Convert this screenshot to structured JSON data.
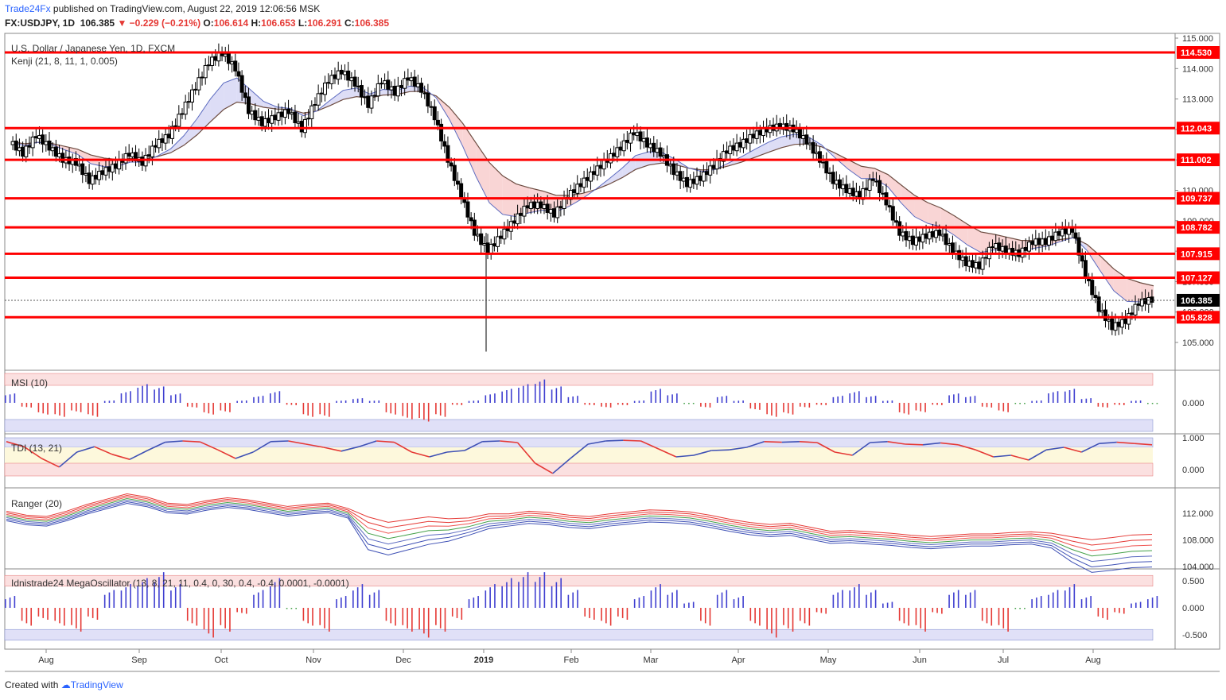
{
  "header": {
    "brand": "Trade24Fx",
    "published": " published on TradingView.com, August 22, 2019 12:06:56 MSK",
    "symbol": "FX:USDJPY, 1D",
    "last": "106.385",
    "arrow": "▼",
    "change": "−0.229 (−0.21%)",
    "o_label": "O:",
    "o": "106.614",
    "h_label": "H:",
    "h": "106.653",
    "l_label": "L:",
    "l": "106.291",
    "c_label": "C:",
    "c": "106.385"
  },
  "footer": {
    "created": "Created with",
    "tradingview": "TradingView"
  },
  "colors": {
    "red_line": "#ff0000",
    "buy": "#3f3fd0",
    "sell": "#e53935",
    "pink_zone": "#fbd8d8",
    "blue_zone": "#dcdcf5"
  },
  "chart_data": [
    {
      "panel": "main",
      "type": "candlestick",
      "title": "U.S. Dollar / Japanese Yen, 1D, FXCM",
      "indicator": "Kenji (21, 8, 11, 1, 0.005)",
      "ylim": [
        104.2,
        115.1
      ],
      "y_ticks": [
        "115.000",
        "114.000",
        "113.000",
        "112.000",
        "111.000",
        "110.000",
        "109.000",
        "108.000",
        "107.000",
        "106.000",
        "105.000"
      ],
      "x_labels": [
        "Aug",
        "Sep",
        "Oct",
        "Nov",
        "Dec",
        "2019",
        "Feb",
        "Mar",
        "Apr",
        "May",
        "Jun",
        "Jul",
        "Aug"
      ],
      "levels": [
        "114.530",
        "112.043",
        "111.002",
        "109.737",
        "108.782",
        "107.915",
        "107.127",
        "105.828"
      ],
      "last_price": "106.385",
      "close_path": [
        111.6,
        111.2,
        111.8,
        111.4,
        111.0,
        110.9,
        110.3,
        110.6,
        110.8,
        111.2,
        110.9,
        111.5,
        111.8,
        112.6,
        113.4,
        114.2,
        114.5,
        114.0,
        112.6,
        112.2,
        112.4,
        112.6,
        112.0,
        112.9,
        113.6,
        113.9,
        113.5,
        112.8,
        113.6,
        113.2,
        113.7,
        113.3,
        112.4,
        111.0,
        109.8,
        108.6,
        108.0,
        108.5,
        109.0,
        109.5,
        109.5,
        109.2,
        109.8,
        110.2,
        110.6,
        111.0,
        111.4,
        111.9,
        111.5,
        111.2,
        110.6,
        110.2,
        110.4,
        110.8,
        111.3,
        111.5,
        111.8,
        112.0,
        112.1,
        112.0,
        111.6,
        111.0,
        110.3,
        110.0,
        109.8,
        110.4,
        109.6,
        108.6,
        108.3,
        108.5,
        108.6,
        108.0,
        107.6,
        107.5,
        108.2,
        108.0,
        107.9,
        108.3,
        108.3,
        108.6,
        108.7,
        107.2,
        106.1,
        105.5,
        105.7,
        106.3,
        106.4
      ]
    },
    {
      "panel": "msi",
      "type": "bar",
      "title": "MSI (10)",
      "y_ticks": [
        "0.000"
      ],
      "values": [
        0.4,
        -0.2,
        -0.5,
        -0.6,
        -0.4,
        -0.6,
        0.1,
        0.5,
        0.8,
        0.7,
        0.4,
        -0.2,
        -0.5,
        -0.4,
        0.1,
        0.3,
        0.5,
        -0.1,
        -0.6,
        -0.6,
        0.1,
        0.2,
        0.1,
        -0.5,
        -0.7,
        -0.8,
        -0.6,
        -0.1,
        0.1,
        0.4,
        0.6,
        0.8,
        1.0,
        0.7,
        0.3,
        -0.1,
        -0.2,
        -0.1,
        0.1,
        0.6,
        0.4,
        0.0,
        -0.2,
        0.3,
        0.1,
        -0.3,
        -0.6,
        -0.5,
        -0.2,
        -0.1,
        0.3,
        0.5,
        0.3,
        0.1,
        -0.5,
        -0.4,
        -0.1,
        0.4,
        0.3,
        -0.2,
        -0.4,
        0.0,
        0.1,
        0.5,
        0.6,
        0.2,
        -0.2,
        -0.1,
        0.1,
        0.0
      ]
    },
    {
      "panel": "tdi",
      "type": "line",
      "title": "TDI (13, 21)",
      "y_ticks": [
        "1.000",
        "0.000"
      ],
      "values": [
        0.88,
        0.72,
        0.35,
        0.08,
        0.55,
        0.72,
        0.48,
        0.32,
        0.6,
        0.86,
        0.9,
        0.87,
        0.62,
        0.35,
        0.55,
        0.88,
        0.9,
        0.8,
        0.7,
        0.58,
        0.72,
        0.9,
        0.86,
        0.55,
        0.4,
        0.55,
        0.6,
        0.88,
        0.9,
        0.85,
        0.2,
        -0.12,
        0.35,
        0.8,
        0.9,
        0.92,
        0.9,
        0.65,
        0.4,
        0.45,
        0.6,
        0.62,
        0.7,
        0.88,
        0.86,
        0.88,
        0.85,
        0.55,
        0.45,
        0.85,
        0.88,
        0.8,
        0.78,
        0.84,
        0.78,
        0.62,
        0.4,
        0.45,
        0.3,
        0.62,
        0.7,
        0.55,
        0.82,
        0.86,
        0.82,
        0.78
      ]
    },
    {
      "panel": "ranger",
      "type": "line",
      "title": "Ranger (20)",
      "y_ticks": [
        "112.000",
        "108.000",
        "104.000"
      ],
      "mid": [
        111.6,
        111.0,
        110.8,
        111.6,
        112.6,
        113.4,
        114.2,
        113.7,
        112.8,
        112.6,
        113.2,
        113.6,
        113.3,
        112.8,
        112.3,
        112.6,
        112.8,
        112.0,
        109.0,
        108.2,
        108.8,
        109.4,
        109.5,
        110.0,
        110.8,
        111.0,
        111.4,
        111.2,
        110.8,
        110.6,
        111.0,
        111.3,
        111.6,
        111.5,
        111.3,
        110.8,
        110.2,
        109.7,
        109.4,
        109.6,
        109.0,
        108.4,
        108.5,
        108.3,
        108.1,
        107.8,
        107.6,
        107.8,
        108.0,
        108.0,
        108.2,
        108.3,
        107.9,
        106.6,
        105.6,
        105.9,
        106.3,
        106.4
      ],
      "spread": [
        0,
        0,
        0,
        0,
        0,
        0,
        0,
        0,
        0,
        0,
        0,
        0,
        0,
        0,
        0,
        0,
        0,
        0,
        0.9,
        0.9,
        0.8,
        0.7,
        0.5,
        0.3,
        0.2,
        0.1,
        0.1,
        0.1,
        0.1,
        0.1,
        0.1,
        0.1,
        0.1,
        0.1,
        0.1,
        0.1,
        0.1,
        0.1,
        0.1,
        0.1,
        0.1,
        0.1,
        0.1,
        0.1,
        0.1,
        0.1,
        0.1,
        0.1,
        0.1,
        0.1,
        0.1,
        0.1,
        0.2,
        0.6,
        0.9,
        0.9,
        0.9,
        0.9
      ]
    },
    {
      "panel": "mega",
      "type": "bar",
      "title": "Idnistrade24 MegaOscillator (13, 8, 21, 11, 0.4, 0, 30, 0.4, -0.4, 0.0001, -0.0001)",
      "y_ticks": [
        "0.500",
        "0.000",
        "-0.500"
      ],
      "values": [
        0.2,
        -0.3,
        -0.2,
        -0.3,
        -0.4,
        -0.2,
        0.3,
        0.4,
        0.5,
        0.6,
        0.4,
        -0.3,
        -0.5,
        -0.4,
        -0.1,
        0.3,
        0.5,
        0.0,
        -0.3,
        -0.4,
        0.2,
        0.4,
        0.3,
        -0.3,
        -0.4,
        -0.5,
        -0.4,
        -0.2,
        0.2,
        0.4,
        0.5,
        0.6,
        0.6,
        0.5,
        0.3,
        -0.2,
        -0.3,
        -0.2,
        0.2,
        0.4,
        0.3,
        0.1,
        -0.3,
        0.3,
        0.2,
        -0.3,
        -0.5,
        -0.4,
        -0.3,
        -0.1,
        0.3,
        0.4,
        0.3,
        0.1,
        -0.3,
        -0.4,
        -0.1,
        0.3,
        0.3,
        -0.3,
        -0.4,
        0.0,
        0.2,
        0.3,
        0.4,
        0.2,
        -0.2,
        -0.1,
        0.1,
        0.2
      ]
    }
  ]
}
